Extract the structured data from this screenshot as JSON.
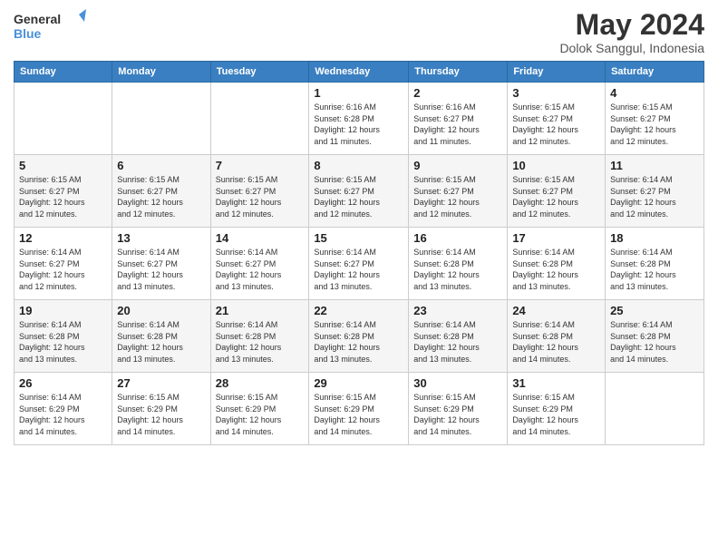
{
  "header": {
    "logo_line1": "General",
    "logo_line2": "Blue",
    "title": "May 2024",
    "location": "Dolok Sanggul, Indonesia"
  },
  "weekdays": [
    "Sunday",
    "Monday",
    "Tuesday",
    "Wednesday",
    "Thursday",
    "Friday",
    "Saturday"
  ],
  "weeks": [
    [
      {
        "day": "",
        "info": ""
      },
      {
        "day": "",
        "info": ""
      },
      {
        "day": "",
        "info": ""
      },
      {
        "day": "1",
        "info": "Sunrise: 6:16 AM\nSunset: 6:28 PM\nDaylight: 12 hours\nand 11 minutes."
      },
      {
        "day": "2",
        "info": "Sunrise: 6:16 AM\nSunset: 6:27 PM\nDaylight: 12 hours\nand 11 minutes."
      },
      {
        "day": "3",
        "info": "Sunrise: 6:15 AM\nSunset: 6:27 PM\nDaylight: 12 hours\nand 12 minutes."
      },
      {
        "day": "4",
        "info": "Sunrise: 6:15 AM\nSunset: 6:27 PM\nDaylight: 12 hours\nand 12 minutes."
      }
    ],
    [
      {
        "day": "5",
        "info": "Sunrise: 6:15 AM\nSunset: 6:27 PM\nDaylight: 12 hours\nand 12 minutes."
      },
      {
        "day": "6",
        "info": "Sunrise: 6:15 AM\nSunset: 6:27 PM\nDaylight: 12 hours\nand 12 minutes."
      },
      {
        "day": "7",
        "info": "Sunrise: 6:15 AM\nSunset: 6:27 PM\nDaylight: 12 hours\nand 12 minutes."
      },
      {
        "day": "8",
        "info": "Sunrise: 6:15 AM\nSunset: 6:27 PM\nDaylight: 12 hours\nand 12 minutes."
      },
      {
        "day": "9",
        "info": "Sunrise: 6:15 AM\nSunset: 6:27 PM\nDaylight: 12 hours\nand 12 minutes."
      },
      {
        "day": "10",
        "info": "Sunrise: 6:15 AM\nSunset: 6:27 PM\nDaylight: 12 hours\nand 12 minutes."
      },
      {
        "day": "11",
        "info": "Sunrise: 6:14 AM\nSunset: 6:27 PM\nDaylight: 12 hours\nand 12 minutes."
      }
    ],
    [
      {
        "day": "12",
        "info": "Sunrise: 6:14 AM\nSunset: 6:27 PM\nDaylight: 12 hours\nand 12 minutes."
      },
      {
        "day": "13",
        "info": "Sunrise: 6:14 AM\nSunset: 6:27 PM\nDaylight: 12 hours\nand 13 minutes."
      },
      {
        "day": "14",
        "info": "Sunrise: 6:14 AM\nSunset: 6:27 PM\nDaylight: 12 hours\nand 13 minutes."
      },
      {
        "day": "15",
        "info": "Sunrise: 6:14 AM\nSunset: 6:27 PM\nDaylight: 12 hours\nand 13 minutes."
      },
      {
        "day": "16",
        "info": "Sunrise: 6:14 AM\nSunset: 6:28 PM\nDaylight: 12 hours\nand 13 minutes."
      },
      {
        "day": "17",
        "info": "Sunrise: 6:14 AM\nSunset: 6:28 PM\nDaylight: 12 hours\nand 13 minutes."
      },
      {
        "day": "18",
        "info": "Sunrise: 6:14 AM\nSunset: 6:28 PM\nDaylight: 12 hours\nand 13 minutes."
      }
    ],
    [
      {
        "day": "19",
        "info": "Sunrise: 6:14 AM\nSunset: 6:28 PM\nDaylight: 12 hours\nand 13 minutes."
      },
      {
        "day": "20",
        "info": "Sunrise: 6:14 AM\nSunset: 6:28 PM\nDaylight: 12 hours\nand 13 minutes."
      },
      {
        "day": "21",
        "info": "Sunrise: 6:14 AM\nSunset: 6:28 PM\nDaylight: 12 hours\nand 13 minutes."
      },
      {
        "day": "22",
        "info": "Sunrise: 6:14 AM\nSunset: 6:28 PM\nDaylight: 12 hours\nand 13 minutes."
      },
      {
        "day": "23",
        "info": "Sunrise: 6:14 AM\nSunset: 6:28 PM\nDaylight: 12 hours\nand 13 minutes."
      },
      {
        "day": "24",
        "info": "Sunrise: 6:14 AM\nSunset: 6:28 PM\nDaylight: 12 hours\nand 14 minutes."
      },
      {
        "day": "25",
        "info": "Sunrise: 6:14 AM\nSunset: 6:28 PM\nDaylight: 12 hours\nand 14 minutes."
      }
    ],
    [
      {
        "day": "26",
        "info": "Sunrise: 6:14 AM\nSunset: 6:29 PM\nDaylight: 12 hours\nand 14 minutes."
      },
      {
        "day": "27",
        "info": "Sunrise: 6:15 AM\nSunset: 6:29 PM\nDaylight: 12 hours\nand 14 minutes."
      },
      {
        "day": "28",
        "info": "Sunrise: 6:15 AM\nSunset: 6:29 PM\nDaylight: 12 hours\nand 14 minutes."
      },
      {
        "day": "29",
        "info": "Sunrise: 6:15 AM\nSunset: 6:29 PM\nDaylight: 12 hours\nand 14 minutes."
      },
      {
        "day": "30",
        "info": "Sunrise: 6:15 AM\nSunset: 6:29 PM\nDaylight: 12 hours\nand 14 minutes."
      },
      {
        "day": "31",
        "info": "Sunrise: 6:15 AM\nSunset: 6:29 PM\nDaylight: 12 hours\nand 14 minutes."
      },
      {
        "day": "",
        "info": ""
      }
    ]
  ]
}
